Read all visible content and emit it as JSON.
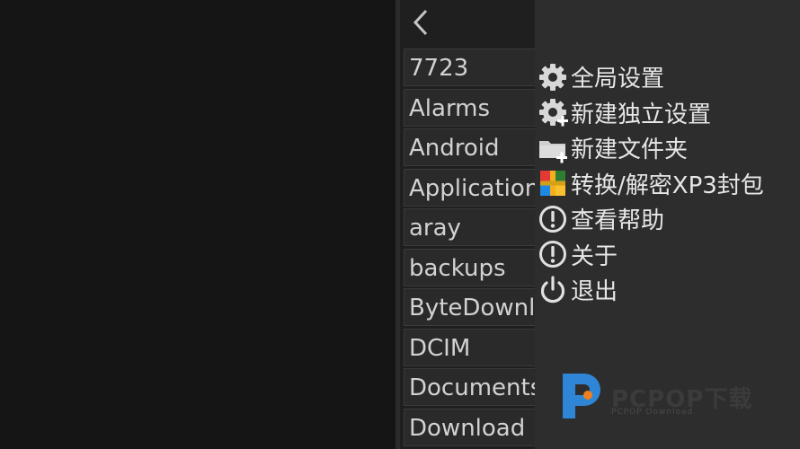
{
  "file_panel": {
    "back_icon": "chevron-left-icon",
    "items": [
      "7723",
      "Alarms",
      "Android",
      "Applications",
      "aray",
      "backups",
      "ByteDownload",
      "DCIM",
      "Documents",
      "Download"
    ]
  },
  "menu": {
    "items": [
      {
        "label": "全局设置",
        "icon": "gear-icon"
      },
      {
        "label": "新建独立设置",
        "icon": "gear-add-icon"
      },
      {
        "label": "新建文件夹",
        "icon": "folder-add-icon"
      },
      {
        "label": "转换/解密XP3封包",
        "icon": "package-icon"
      },
      {
        "label": "查看帮助",
        "icon": "exclamation-circle-icon"
      },
      {
        "label": "关于",
        "icon": "exclamation-circle-icon"
      },
      {
        "label": "退出",
        "icon": "power-icon"
      }
    ]
  },
  "watermark": {
    "brand": "PCPOP下载",
    "sub": "PCPOP Download"
  },
  "colors": {
    "logo_blue": "#2f86d6",
    "logo_orange": "#f07f1e"
  }
}
